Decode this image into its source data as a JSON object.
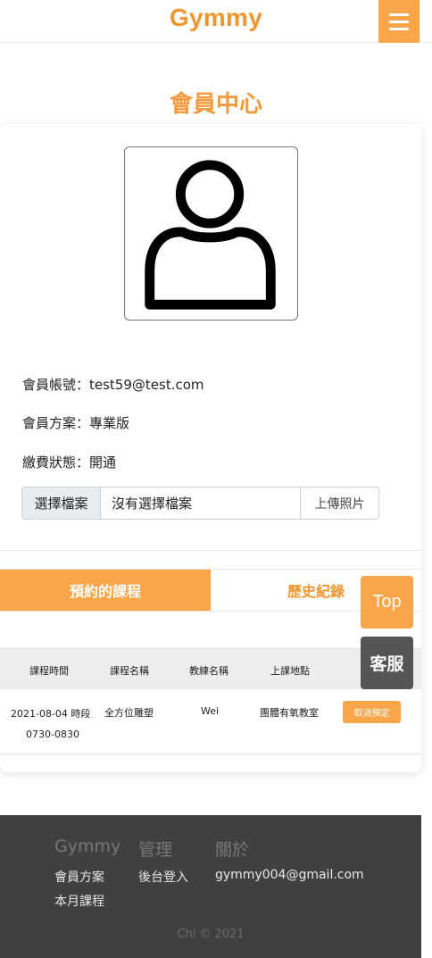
{
  "header": {
    "brand": "Gymmy",
    "menu_icon": "hamburger-icon",
    "accent": "#F9A54A"
  },
  "page_title": "會員中心",
  "profile": {
    "avatar_icon": "user-avatar-icon",
    "account": "會員帳號：test59@test.com",
    "plan": "會員方案：專業版",
    "payment": "繳費狀態：開通",
    "file_choose_label": "選擇檔案",
    "file_name": "沒有選擇檔案",
    "upload_label": "上傳照片"
  },
  "tabs": [
    {
      "label": "預約的課程",
      "active": true
    },
    {
      "label": "歷史紀錄",
      "active": false
    }
  ],
  "table": {
    "headers": [
      "課程時間",
      "課程名稱",
      "教練名稱",
      "上課地點"
    ],
    "rows": [
      {
        "time_line1": "2021-08-04 時段",
        "time_line2": "0730-0830",
        "course": "全方位雕塑",
        "coach": "Wei",
        "location": "團體有氧教室",
        "action": "取消預定"
      }
    ]
  },
  "floating": {
    "top": "Top",
    "service": "客服"
  },
  "footer": {
    "columns": [
      "Gymmy",
      "管理",
      "關於"
    ],
    "links": [
      "會員方案",
      "本月課程",
      "後台登入",
      "gymmy004@gmail.com"
    ],
    "copyright": "Chi © 2021"
  }
}
